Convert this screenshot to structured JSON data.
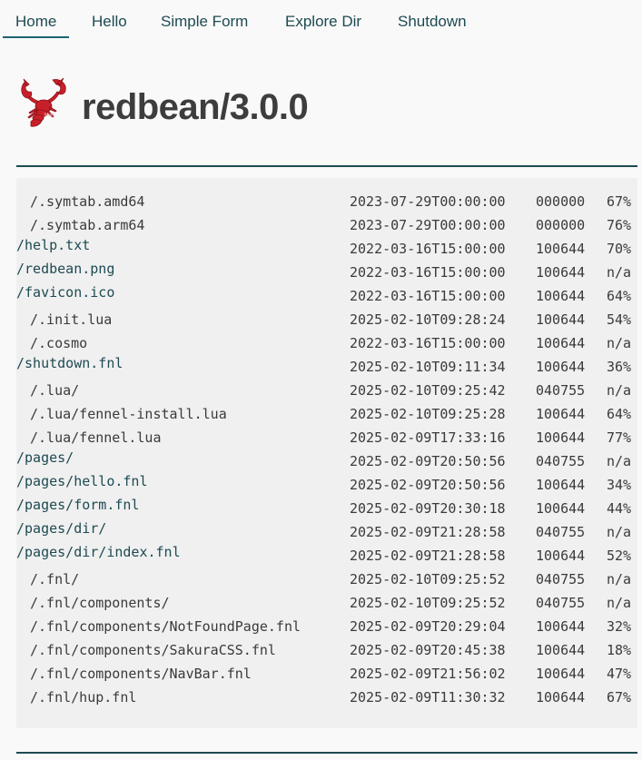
{
  "nav": {
    "items": [
      {
        "label": "Home",
        "active": true
      },
      {
        "label": "Hello",
        "active": false
      },
      {
        "label": "Simple Form",
        "active": false
      },
      {
        "label": "Explore Dir",
        "active": false
      },
      {
        "label": "Shutdown",
        "active": false
      }
    ]
  },
  "header": {
    "title": "redbean/3.0.0",
    "logo_icon": "lobster-logo-icon"
  },
  "colors": {
    "accent": "#1d4a52",
    "background": "#f9f9f9",
    "listing_background": "#f0f0f0",
    "logo_red": "#c8202a"
  },
  "listing": {
    "rows": [
      {
        "name": "/.symtab.amd64",
        "link": false,
        "date": "2023-07-29T00:00:00",
        "mode": "000000",
        "ratio": "67%"
      },
      {
        "name": "/.symtab.arm64",
        "link": false,
        "date": "2023-07-29T00:00:00",
        "mode": "000000",
        "ratio": "76%"
      },
      {
        "name": "/help.txt",
        "link": true,
        "date": "2022-03-16T15:00:00",
        "mode": "100644",
        "ratio": "70%"
      },
      {
        "name": "/redbean.png",
        "link": true,
        "date": "2022-03-16T15:00:00",
        "mode": "100644",
        "ratio": "n/a"
      },
      {
        "name": "/favicon.ico",
        "link": true,
        "date": "2022-03-16T15:00:00",
        "mode": "100644",
        "ratio": "64%"
      },
      {
        "name": "/.init.lua",
        "link": false,
        "date": "2025-02-10T09:28:24",
        "mode": "100644",
        "ratio": "54%"
      },
      {
        "name": "/.cosmo",
        "link": false,
        "date": "2022-03-16T15:00:00",
        "mode": "100644",
        "ratio": "n/a"
      },
      {
        "name": "/shutdown.fnl",
        "link": true,
        "date": "2025-02-10T09:11:34",
        "mode": "100644",
        "ratio": "36%"
      },
      {
        "name": "/.lua/",
        "link": false,
        "date": "2025-02-10T09:25:42",
        "mode": "040755",
        "ratio": "n/a"
      },
      {
        "name": "/.lua/fennel-install.lua",
        "link": false,
        "date": "2025-02-10T09:25:28",
        "mode": "100644",
        "ratio": "64%"
      },
      {
        "name": "/.lua/fennel.lua",
        "link": false,
        "date": "2025-02-09T17:33:16",
        "mode": "100644",
        "ratio": "77%"
      },
      {
        "name": "/pages/",
        "link": true,
        "date": "2025-02-09T20:50:56",
        "mode": "040755",
        "ratio": "n/a"
      },
      {
        "name": "/pages/hello.fnl",
        "link": true,
        "date": "2025-02-09T20:50:56",
        "mode": "100644",
        "ratio": "34%"
      },
      {
        "name": "/pages/form.fnl",
        "link": true,
        "date": "2025-02-09T20:30:18",
        "mode": "100644",
        "ratio": "44%"
      },
      {
        "name": "/pages/dir/",
        "link": true,
        "date": "2025-02-09T21:28:58",
        "mode": "040755",
        "ratio": "n/a"
      },
      {
        "name": "/pages/dir/index.fnl",
        "link": true,
        "date": "2025-02-09T21:28:58",
        "mode": "100644",
        "ratio": "52%"
      },
      {
        "name": "/.fnl/",
        "link": false,
        "date": "2025-02-10T09:25:52",
        "mode": "040755",
        "ratio": "n/a"
      },
      {
        "name": "/.fnl/components/",
        "link": false,
        "date": "2025-02-10T09:25:52",
        "mode": "040755",
        "ratio": "n/a"
      },
      {
        "name": "/.fnl/components/NotFoundPage.fnl",
        "link": false,
        "date": "2025-02-09T20:29:04",
        "mode": "100644",
        "ratio": "32%"
      },
      {
        "name": "/.fnl/components/SakuraCSS.fnl",
        "link": false,
        "date": "2025-02-09T20:45:38",
        "mode": "100644",
        "ratio": "18%"
      },
      {
        "name": "/.fnl/components/NavBar.fnl",
        "link": false,
        "date": "2025-02-09T21:56:02",
        "mode": "100644",
        "ratio": "47%"
      },
      {
        "name": "/.fnl/hup.fnl",
        "link": false,
        "date": "2025-02-09T11:30:32",
        "mode": "100644",
        "ratio": "67%"
      }
    ]
  }
}
